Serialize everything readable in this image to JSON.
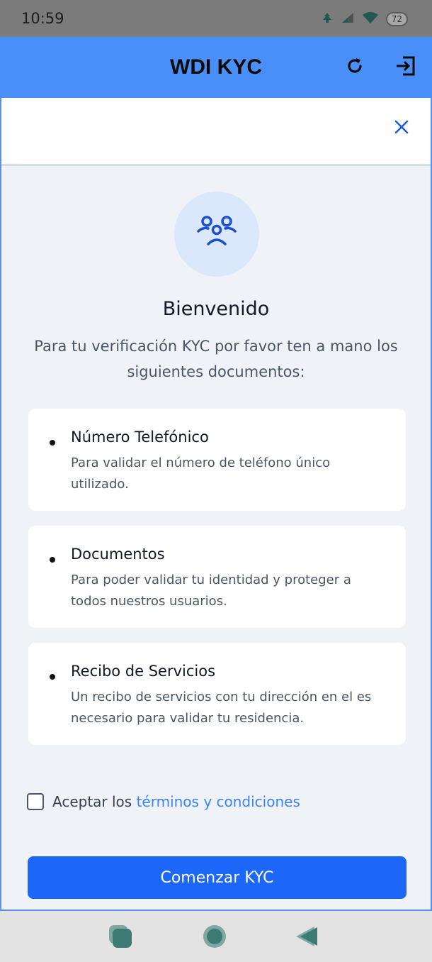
{
  "status_bar": {
    "time": "10:59",
    "battery": "72",
    "icons": [
      "notification-icon",
      "signal-icon",
      "wifi-icon",
      "battery-icon"
    ]
  },
  "header": {
    "title": "WDI KYC",
    "icons": [
      "refresh-icon",
      "logout-icon"
    ],
    "background_color": "#4a8ff8"
  },
  "top_card": {
    "icons": [
      "close-icon"
    ],
    "accent_color": "#1d5fd6"
  },
  "welcome": {
    "icon": "users-icon",
    "title": "Bienvenido",
    "intro": "Para tu verificación KYC por favor ten a mano los siguientes documentos:"
  },
  "documents": [
    {
      "title": "Número Telefónico",
      "description": "Para validar el número de teléfono único utilizado."
    },
    {
      "title": "Documentos",
      "description": "Para poder validar tu identidad y proteger a todos nuestros usuarios."
    },
    {
      "title": "Recibo de Servicios",
      "description": "Un recibo de servicios con tu dirección en el es necesario para validar tu residencia."
    }
  ],
  "terms": {
    "label": "Aceptar los",
    "link": "términos y condiciones",
    "checked": false,
    "link_color": "#3b82f6"
  },
  "primary_button": {
    "label": "Comenzar KYC",
    "color": "#1d67f8"
  },
  "nav_bar": {
    "icons": [
      "recents-icon",
      "home-icon",
      "back-icon"
    ],
    "icon_color": "#3e7a74"
  }
}
